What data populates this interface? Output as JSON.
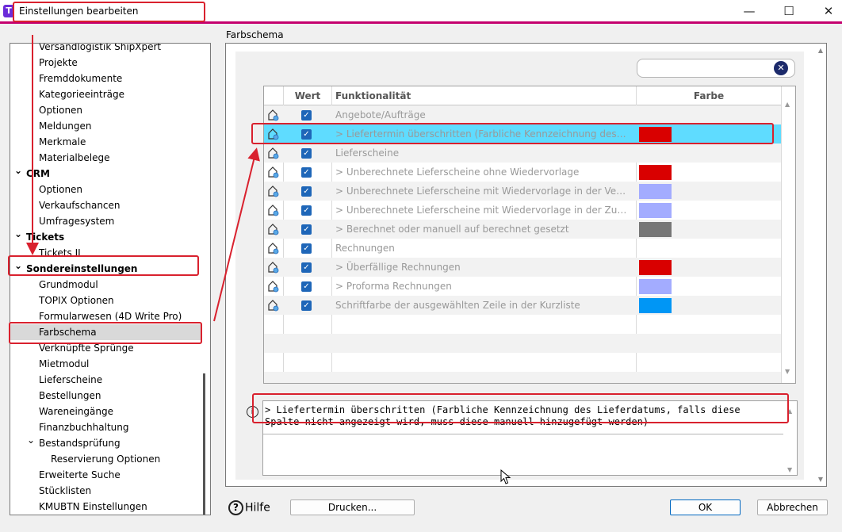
{
  "window": {
    "title": "Einstellungen bearbeiten",
    "app_icon": "T"
  },
  "section_title": "Farbschema",
  "tree": [
    {
      "label": "Versandlogistik ShipXpert",
      "level": 1
    },
    {
      "label": "Projekte",
      "level": 1
    },
    {
      "label": "Fremddokumente",
      "level": 1
    },
    {
      "label": "Kategorieeinträge",
      "level": 1
    },
    {
      "label": "Optionen",
      "level": 1
    },
    {
      "label": "Meldungen",
      "level": 1
    },
    {
      "label": "Merkmale",
      "level": 1
    },
    {
      "label": "Materialbelege",
      "level": 1
    },
    {
      "label": "CRM",
      "level": 0,
      "expanded": true
    },
    {
      "label": "Optionen",
      "level": 1
    },
    {
      "label": "Verkaufschancen",
      "level": 1
    },
    {
      "label": "Umfragesystem",
      "level": 1
    },
    {
      "label": "Tickets",
      "level": 0,
      "expanded": true
    },
    {
      "label": "Tickets II",
      "level": 1
    },
    {
      "label": "Sondereinstellungen",
      "level": 0,
      "expanded": true
    },
    {
      "label": "Grundmodul",
      "level": 1
    },
    {
      "label": "TOPIX Optionen",
      "level": 1
    },
    {
      "label": "Formularwesen (4D Write Pro)",
      "level": 1
    },
    {
      "label": "Farbschema",
      "level": 1,
      "selected": true
    },
    {
      "label": "Verknüpfte Sprünge",
      "level": 1
    },
    {
      "label": "Mietmodul",
      "level": 1
    },
    {
      "label": "Lieferscheine",
      "level": 1
    },
    {
      "label": "Bestellungen",
      "level": 1
    },
    {
      "label": "Wareneingänge",
      "level": 1
    },
    {
      "label": "Finanzbuchhaltung",
      "level": 1
    },
    {
      "label": "Bestandsprüfung",
      "level": 1,
      "expanded": true
    },
    {
      "label": "Reservierung Optionen",
      "level": 2
    },
    {
      "label": "Erweiterte Suche",
      "level": 1
    },
    {
      "label": "Stücklisten",
      "level": 1
    },
    {
      "label": "KMUBTN Einstellungen",
      "level": 1
    }
  ],
  "table": {
    "columns": {
      "wert": "Wert",
      "funktionalitaet": "Funktionalität",
      "farbe": "Farbe"
    },
    "rows": [
      {
        "text": "Angebote/Aufträge",
        "checked": true,
        "color": null
      },
      {
        "text": "> Liefertermin überschritten (Farbliche Kennzeichnung des Lieferdatums, falls diese Spalte nicht angezeigt wird)",
        "checked": true,
        "color": "#d90000",
        "selected": true
      },
      {
        "text": "Lieferscheine",
        "checked": true,
        "color": null
      },
      {
        "text": "> Unberechnete Lieferscheine ohne Wiedervorlage",
        "checked": true,
        "color": "#d90000"
      },
      {
        "text": "> Unberechnete Lieferscheine mit Wiedervorlage in der Vergangenheit",
        "checked": true,
        "color": "#a3acff"
      },
      {
        "text": "> Unberechnete Lieferscheine mit Wiedervorlage in der Zukunft",
        "checked": true,
        "color": "#a3acff"
      },
      {
        "text": "> Berechnet oder manuell auf berechnet gesetzt",
        "checked": true,
        "color": "#777777"
      },
      {
        "text": "Rechnungen",
        "checked": true,
        "color": null
      },
      {
        "text": "> Überfällige Rechnungen",
        "checked": true,
        "color": "#d90000"
      },
      {
        "text": "> Proforma Rechnungen",
        "checked": true,
        "color": "#a3acff"
      },
      {
        "text": "Schriftfarbe der ausgewählten Zeile in der Kurzliste",
        "checked": true,
        "color": "#0096f5"
      }
    ]
  },
  "description": "> Liefertermin überschritten (Farbliche Kennzeichnung des Lieferdatums, falls diese Spalte nicht angezeigt wird, muss diese manuell hinzugefügt werden)",
  "buttons": {
    "help": "Hilfe",
    "print": "Drucken...",
    "ok": "OK",
    "cancel": "Abbrechen"
  },
  "colors": {
    "accent_bar": "#c4006e",
    "selection": "#5fdcff",
    "annotation": "#d9212e"
  }
}
